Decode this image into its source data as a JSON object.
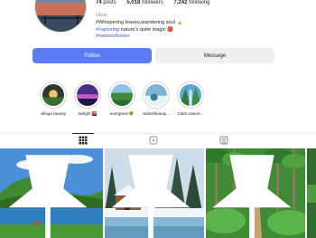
{
  "profile": {
    "stats": [
      {
        "value": "74",
        "label": "posts"
      },
      {
        "value": "5,018",
        "label": "followers"
      },
      {
        "value": "7,242",
        "label": "following"
      }
    ],
    "name": "Ukox",
    "bio_line1": "#Whispering leaves,wandering soul 🍃",
    "bio_line2_tag": "#capturing",
    "bio_line2_text": " nature's quite magic 🎒",
    "bio_line3_tag": "#natureshooter"
  },
  "actions": {
    "follow_label": "Follow",
    "message_label": "Message"
  },
  "highlights": [
    {
      "label": "village beauty"
    },
    {
      "label": "twilight 🌇"
    },
    {
      "label": "evergreen🌳"
    },
    {
      "label": "winterbeauty..."
    },
    {
      "label": "Calm nature..."
    }
  ],
  "tabs": [
    {
      "icon": "grid-icon",
      "active": true
    },
    {
      "icon": "reels-icon",
      "active": false
    },
    {
      "icon": "tagged-icon",
      "active": false
    }
  ],
  "colors": {
    "accent": "#5b7cf6",
    "link": "#3b59c9",
    "muted": "#8e8e8e"
  }
}
